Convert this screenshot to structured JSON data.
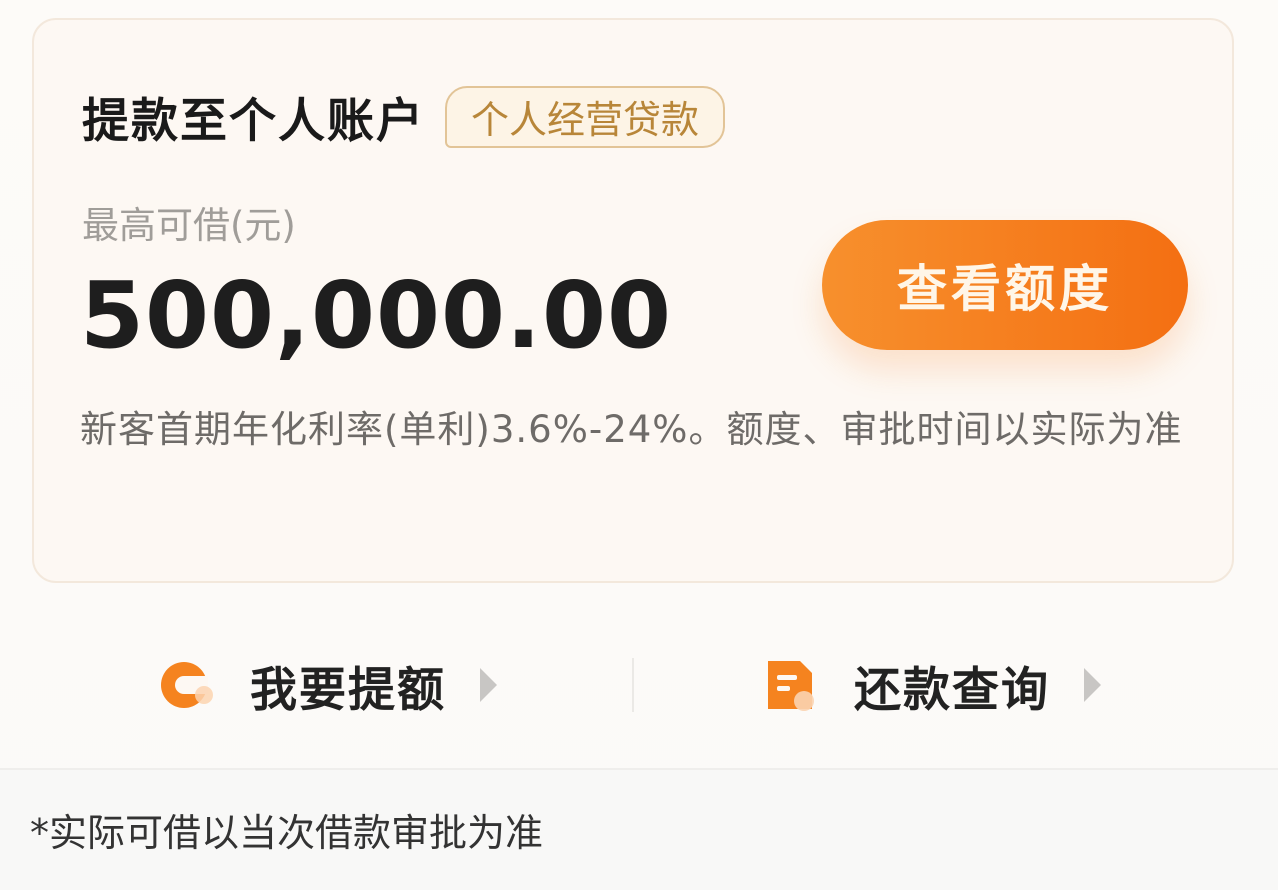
{
  "loan_card": {
    "title": "提款至个人账户",
    "tag": "个人经营贷款",
    "amount_label": "最高可借(元)",
    "amount": "500,000.00",
    "cta_label": "查看额度",
    "rate_note": "新客首期年化利率(单利)3.6%-24%。额度、审批时间以实际为准"
  },
  "actions": {
    "increase_limit": {
      "label": "我要提额",
      "icon": "coin-icon"
    },
    "repayment_query": {
      "label": "还款查询",
      "icon": "document-icon"
    }
  },
  "footer": {
    "note": "*实际可借以当次借款审批为准"
  },
  "colors": {
    "accent": "#f5831f",
    "tag_text": "#b88639",
    "tag_border": "#e2c497",
    "card_bg": "#fdf8f3"
  }
}
